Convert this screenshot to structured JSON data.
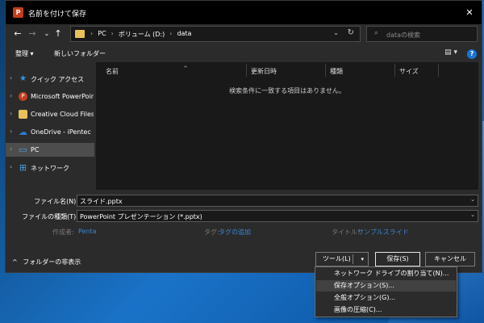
{
  "window": {
    "title": "名前を付けて保存",
    "app_icon": "powerpoint-icon",
    "app_icon_letter": "P",
    "close_glyph": "✕"
  },
  "nav_buttons": {
    "back": "←",
    "forward": "→",
    "recent": "⌄",
    "up": "↑"
  },
  "address": {
    "crumbs": [
      "PC",
      "ボリューム (D:)",
      "data"
    ],
    "separator": "›",
    "dropdown_glyph": "⌄",
    "refresh_glyph": "↻"
  },
  "search": {
    "icon_glyph": "⌕",
    "placeholder": "dataの検索"
  },
  "toolbar": {
    "organize_label": "整理 ▾",
    "new_folder_label": "新しいフォルダー",
    "view_glyph": "▤ ▾",
    "help_glyph": "?"
  },
  "nav_pane": {
    "items": [
      {
        "label": "クイック アクセス",
        "icon": "star-icon",
        "icon_color": "#3a96dd",
        "glyph": "★",
        "selected": false
      },
      {
        "label": "Microsoft PowerPoint",
        "icon": "powerpoint-icon",
        "icon_color": "#c43e1c",
        "glyph": "P",
        "selected": false
      },
      {
        "label": "Creative Cloud Files",
        "icon": "creative-cloud-icon",
        "icon_color": "#e8c15b",
        "glyph": "",
        "selected": false
      },
      {
        "label": "OneDrive - iPentec",
        "icon": "onedrive-icon",
        "icon_color": "#2b7cd3",
        "glyph": "☁",
        "selected": false
      },
      {
        "label": "PC",
        "icon": "pc-icon",
        "icon_color": "#4aa3df",
        "glyph": "▭",
        "selected": true
      },
      {
        "label": "ネットワーク",
        "icon": "network-icon",
        "icon_color": "#4aa3df",
        "glyph": "⊞",
        "selected": false
      }
    ]
  },
  "file_list": {
    "columns": [
      "名前",
      "更新日時",
      "種類",
      "サイズ"
    ],
    "sort_glyph": "^",
    "empty_message": "検索条件に一致する項目はありません。"
  },
  "form": {
    "filename_label": "ファイル名(N):",
    "filename_value": "スライド.pptx",
    "filetype_label": "ファイルの種類(T):",
    "filetype_value": "PowerPoint プレゼンテーション (*.pptx)",
    "author_label": "作成者:",
    "author_value": "Penta",
    "tags_label": "タグ:",
    "tags_value": "タグの追加",
    "title_label": "タイトル:",
    "title_value": "サンプルスライド"
  },
  "footer": {
    "hide_folders_label": "フォルダーの非表示",
    "tools_label": "ツール(L)",
    "save_label": "保存(S)",
    "cancel_label": "キャンセル"
  },
  "tools_menu": {
    "items": [
      {
        "label": "ネットワーク ドライブの割り当て(N)...",
        "hover": false
      },
      {
        "label": "保存オプション(S)...",
        "hover": true
      },
      {
        "label": "全般オプション(G)...",
        "hover": false
      },
      {
        "label": "画像の圧縮(C)...",
        "hover": false
      }
    ]
  }
}
